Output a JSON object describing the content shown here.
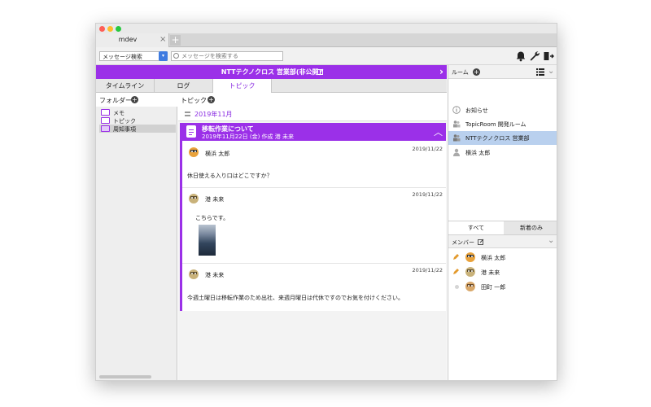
{
  "window": {
    "tab_title": "mdev",
    "tab_close": "×",
    "tab_add": "+"
  },
  "toolbar": {
    "search_mode": "メッセージ検索",
    "search_placeholder": "メッセージを検索する",
    "icons": [
      "bell-icon",
      "wrench-icon",
      "logout-icon"
    ]
  },
  "header": {
    "title": "NTTテクノクロス 営業部(非公開)",
    "arrow": "›"
  },
  "view_tabs": [
    {
      "label": "タイムライン",
      "active": false
    },
    {
      "label": "ログ",
      "active": false
    },
    {
      "label": "トピック",
      "active": true
    }
  ],
  "folders": {
    "heading": "フォルダー",
    "items": [
      {
        "label": "メモ",
        "selected": false
      },
      {
        "label": "トピック",
        "selected": false
      },
      {
        "label": "周知事項",
        "selected": true
      }
    ]
  },
  "topics": {
    "heading": "トピック",
    "month": "2019年11月",
    "topic": {
      "title": "移転作業について",
      "meta": "2019年11月22日 (金) 作成 港 未来",
      "messages": [
        {
          "author": "横浜 太郎",
          "date": "2019/11/22",
          "text": "休日使える入り口はどこですか？",
          "has_image": false
        },
        {
          "author": "港 未来",
          "date": "2019/11/22",
          "text": "こちらです。",
          "has_image": true
        },
        {
          "author": "港 未来",
          "date": "2019/11/22",
          "text": "今週土曜日は移転作業のため出社、来週月曜日は代休ですのでお気を付けください。",
          "has_image": false
        }
      ]
    }
  },
  "rooms": {
    "heading": "ルーム",
    "items": [
      {
        "label": "お知らせ",
        "icon": "info-icon",
        "selected": false
      },
      {
        "label": "TopicRoom 開発ルーム",
        "icon": "group-icon",
        "selected": false
      },
      {
        "label": "NTTテクノクロス 営業部",
        "icon": "group-icon",
        "selected": true
      },
      {
        "label": "横浜 太郎",
        "icon": "person-icon",
        "selected": false
      }
    ]
  },
  "member_tabs": [
    {
      "label": "すべて",
      "active": true
    },
    {
      "label": "新着のみ",
      "active": false
    }
  ],
  "members": {
    "heading": "メンバー",
    "items": [
      {
        "name": "横浜 太郎",
        "status": "pencil"
      },
      {
        "name": "港 未来",
        "status": "pencil"
      },
      {
        "name": "田町 一郎",
        "status": "dot"
      }
    ]
  },
  "colors": {
    "accent": "#9b30e8",
    "selected_room": "#b9d0ee",
    "select_button": "#3d7ae0"
  }
}
